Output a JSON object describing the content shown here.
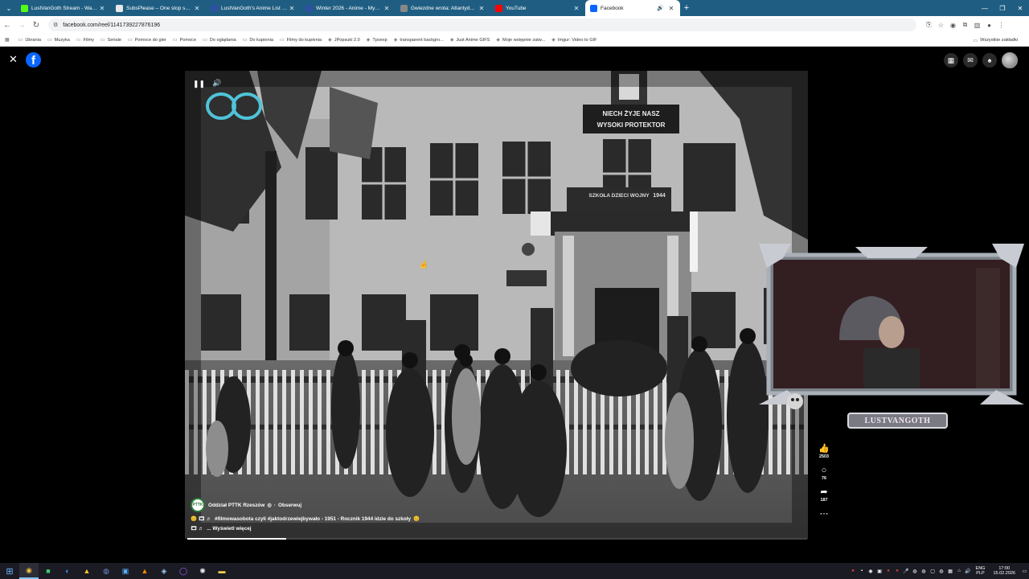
{
  "browser": {
    "tabs": [
      {
        "title": "LustVanGoth Stream - Watch Li",
        "favicon": "kick-icon",
        "color": "#53fc18"
      },
      {
        "title": "SubsPlease – One stop shop fo",
        "favicon": "subsplease-icon",
        "color": "#e8e8e8"
      },
      {
        "title": "LustVanGoth's Anime List - My",
        "favicon": "mal-icon",
        "color": "#2e51a2"
      },
      {
        "title": "Winter 2026 - Anime - MyAnim",
        "favicon": "mal-icon",
        "color": "#2e51a2"
      },
      {
        "title": "Gwiezdne wrota: Atlantyda / St",
        "favicon": "globe-icon",
        "color": "#888888"
      },
      {
        "title": "YouTube",
        "favicon": "youtube-icon",
        "color": "#ff0000"
      },
      {
        "title": "Facebook",
        "favicon": "facebook-icon",
        "color": "#0866ff",
        "active": true
      }
    ],
    "url": "facebook.com/reel/1141739227876196",
    "bookmarks": [
      {
        "label": "Ubrania",
        "icon": "folder-icon"
      },
      {
        "label": "Muzyka",
        "icon": "folder-icon"
      },
      {
        "label": "Filmy",
        "icon": "folder-icon"
      },
      {
        "label": "Seriale",
        "icon": "folder-icon"
      },
      {
        "label": "Pomoce do gier",
        "icon": "folder-icon"
      },
      {
        "label": "Pomoce",
        "icon": "folder-icon"
      },
      {
        "label": "Do oglądania",
        "icon": "folder-icon"
      },
      {
        "label": "Do kupienia",
        "icon": "folder-icon"
      },
      {
        "label": "Filmy do kupienia",
        "icon": "folder-icon"
      },
      {
        "label": "JPopsuki 2.0",
        "icon": "site-icon"
      },
      {
        "label": "Tpxexp",
        "icon": "site-icon"
      },
      {
        "label": "transparent backgro...",
        "icon": "site-icon"
      },
      {
        "label": "Just Anime GIFS",
        "icon": "site-icon"
      },
      {
        "label": "Moje wstępnie zatw...",
        "icon": "site-icon"
      },
      {
        "label": "Imgur: Video to GIF",
        "icon": "site-icon"
      }
    ],
    "all_bookmarks": "Wszystkie zakładki"
  },
  "reel": {
    "author": "Oddział PTTK Rzeszów",
    "follow": "Obserwuj",
    "separator": "·",
    "description": "#filmowasobota czyli #jaktodrzewiejbywało - 1951 - Rocznik 1944 idzie do szkoły",
    "see_more": "... Wyświetl więcej",
    "likes": "2503",
    "comments": "76",
    "shares": "187",
    "progress": 0.16,
    "banner_top": "NIECH ŻYJE NASZ WYSOKI PROTEKTOR",
    "banner_mid": "SZKOŁA DZIECI WOJNY",
    "year": "1944"
  },
  "webcam": {
    "name": "LUSTVANGOTH"
  },
  "taskbar": {
    "lang_top": "ENG",
    "lang_bottom": "PLP",
    "time": "17:00",
    "date": "15.02.2026"
  }
}
